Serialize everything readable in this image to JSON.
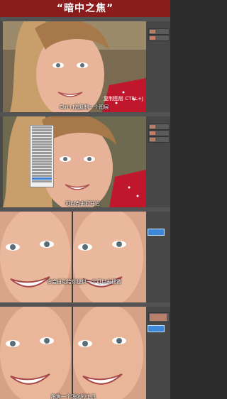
{
  "header": {
    "title": "“暗中之焦”"
  },
  "panels": [
    {
      "caption": "Ctrl+J先复制一个图层",
      "shortcut": "复制图层  CTRL+J"
    },
    {
      "caption": "可以点击打开它"
    },
    {
      "caption": "它会自动给你提供一个可以去拯救"
    },
    {
      "caption": "跟焦一个锐化的工具"
    }
  ],
  "colors": {
    "header_bg": "#8a1c1c",
    "app_bg": "#3b3b3b",
    "accent": "#3a7bd5",
    "sweater": "#c0172c"
  }
}
